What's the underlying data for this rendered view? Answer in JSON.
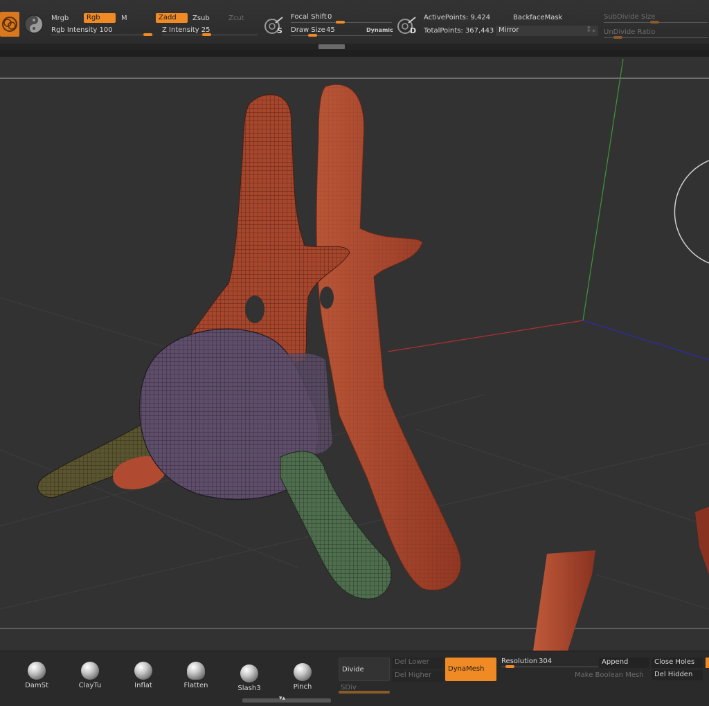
{
  "top_toolbar": {
    "mrgb_label": "Mrgb",
    "rgb_label": "Rgb",
    "m_label": "M",
    "zadd_label": "Zadd",
    "zsub_label": "Zsub",
    "zcut_label": "Zcut",
    "rgb_intensity_label": "Rgb Intensity 100",
    "rgb_intensity_value": 100,
    "z_intensity_label": "Z Intensity 25",
    "z_intensity_value": 25,
    "focal_shift_label": "Focal Shift",
    "focal_shift_value": "0",
    "draw_size_label": "Draw Size",
    "draw_size_value": "45",
    "dynamic_label": "Dynamic",
    "active_points_label": "ActivePoints: 9,424",
    "total_points_label": "TotalPoints: 367,443",
    "backface_mask_label": "BackfaceMask",
    "mirror_label": "Mirror",
    "subdivide_size_label": "SubDivide Size",
    "undivide_ratio_label": "UnDivide Ratio",
    "focal_icon_letter": "S",
    "draw_icon_letter": "D"
  },
  "brushes": [
    {
      "label": "DamSt",
      "icon": "damstandard-brush-icon"
    },
    {
      "label": "ClayTu",
      "icon": "claytubes-brush-icon"
    },
    {
      "label": "Inflat",
      "icon": "inflate-brush-icon"
    },
    {
      "label": "Flatten",
      "icon": "flatten-brush-icon"
    },
    {
      "label": "Slash3",
      "icon": "slash3-brush-icon"
    },
    {
      "label": "Pinch",
      "icon": "pinch-brush-icon"
    }
  ],
  "geometry_panel": {
    "divide_label": "Divide",
    "sdiv_label": "SDiv",
    "del_lower_label": "Del Lower",
    "del_higher_label": "Del Higher",
    "dynamesh_label": "DynaMesh",
    "resolution_label": "Resolution",
    "resolution_value": "304",
    "append_label": "Append",
    "close_holes_label": "Close Holes",
    "make_boolean_label": "Make Boolean Mesh",
    "del_hidden_label": "Del Hidden"
  },
  "colors": {
    "accent": "#f08a24",
    "mesh_red": "#a3432b",
    "mesh_purple": "#5e4e6a",
    "mesh_green": "#4f6e4e",
    "axis_red": "#b03030",
    "axis_green": "#3a9a3a",
    "axis_blue": "#2b2bb0"
  }
}
